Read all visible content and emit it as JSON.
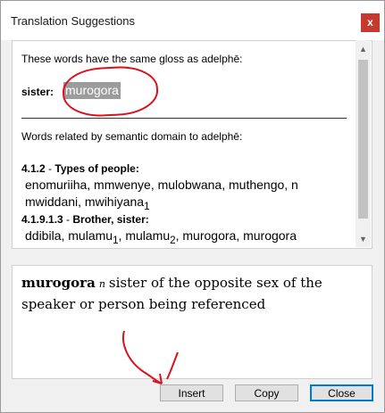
{
  "window": {
    "title": "Translation Suggestions",
    "close_glyph": "x"
  },
  "same_gloss": {
    "intro_prefix": "These words have the same gloss as ",
    "intro_word": "adelphē",
    "intro_suffix": ":",
    "label": "sister:",
    "selected_word": "murogora"
  },
  "semantic": {
    "intro_prefix": "Words related by semantic domain to ",
    "intro_word": "adelphē",
    "intro_suffix": ":",
    "domains": [
      {
        "code": "4.1.2",
        "sep": " - ",
        "name": "Types of people:",
        "line1": "enomuriiha, mmwenye, mulobwana, muthengo, n",
        "line2_text": "mwiddani, mwihiyana",
        "line2_sub": "1"
      },
      {
        "code": "4.1.9.1.3",
        "sep": " - ",
        "name": "Brother, sister:",
        "p1": "ddibila, mulamu",
        "s1": "1",
        "p2": ", mulamu",
        "s2": "2",
        "p3": ", murogora, murogora"
      }
    ]
  },
  "definition": {
    "headword": "murogora",
    "pos": "n",
    "gloss_line1": "sister of the opposite sex of the",
    "gloss_line2": "speaker or person being referenced"
  },
  "buttons": {
    "insert": "Insert",
    "copy": "Copy",
    "close": "Close"
  },
  "annotation_color": "#d8121a"
}
